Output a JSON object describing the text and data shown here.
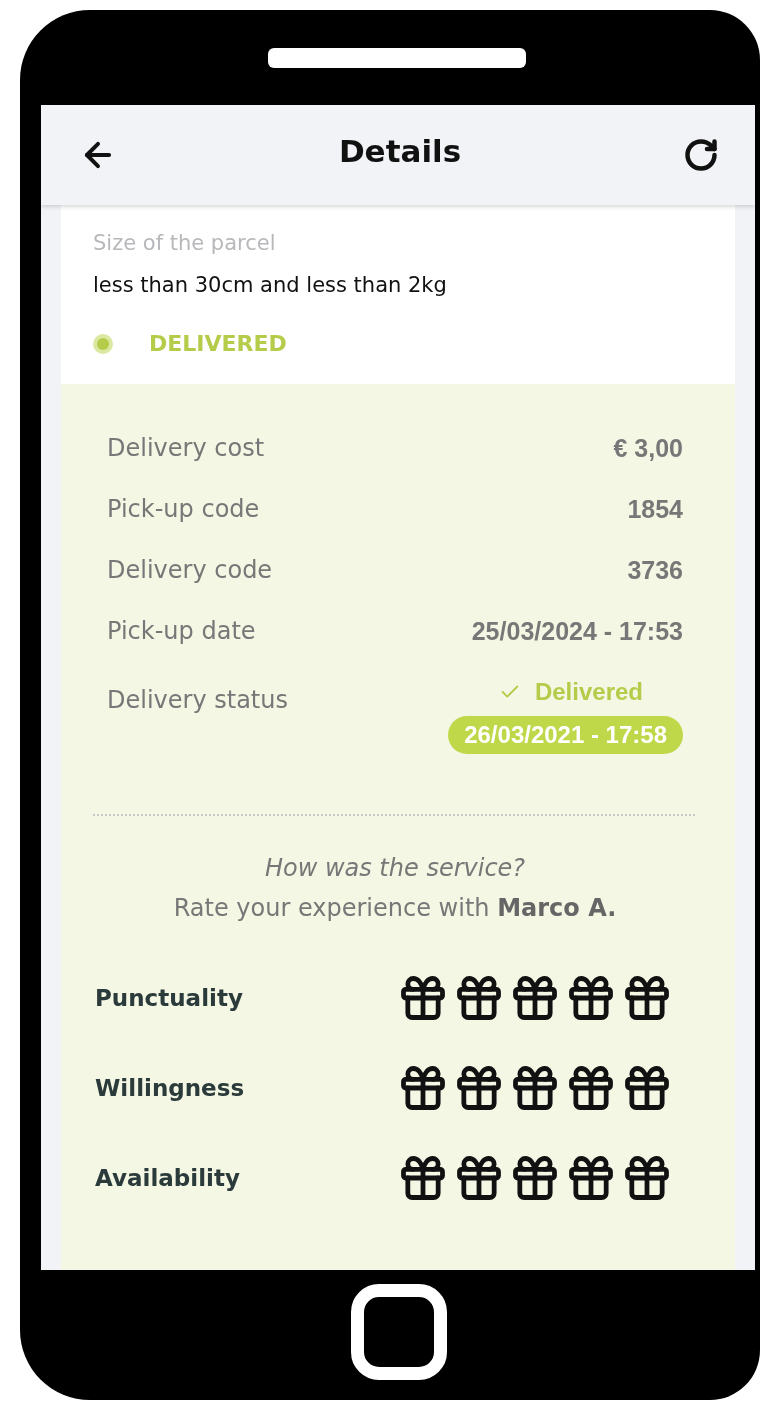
{
  "header": {
    "title": "Details"
  },
  "parcel": {
    "size_label": "Size of the parcel",
    "size_value": "less than 30cm and less than 2kg",
    "status": "DELIVERED"
  },
  "details": [
    {
      "label": "Delivery cost",
      "value": "€ 3,00"
    },
    {
      "label": "Pick-up code",
      "value": "1854"
    },
    {
      "label": "Delivery code",
      "value": "3736"
    },
    {
      "label": "Pick-up date",
      "value": "25/03/2024 - 17:53"
    }
  ],
  "delivery_status": {
    "label": "Delivery status",
    "status": "Delivered",
    "timestamp": "26/03/2021 - 17:58"
  },
  "rating": {
    "question": "How was the service?",
    "prompt": "Rate your experience with **Marco A.**",
    "criteria": [
      {
        "label": "Punctuality"
      },
      {
        "label": "Willingness"
      },
      {
        "label": "Availability"
      }
    ]
  }
}
